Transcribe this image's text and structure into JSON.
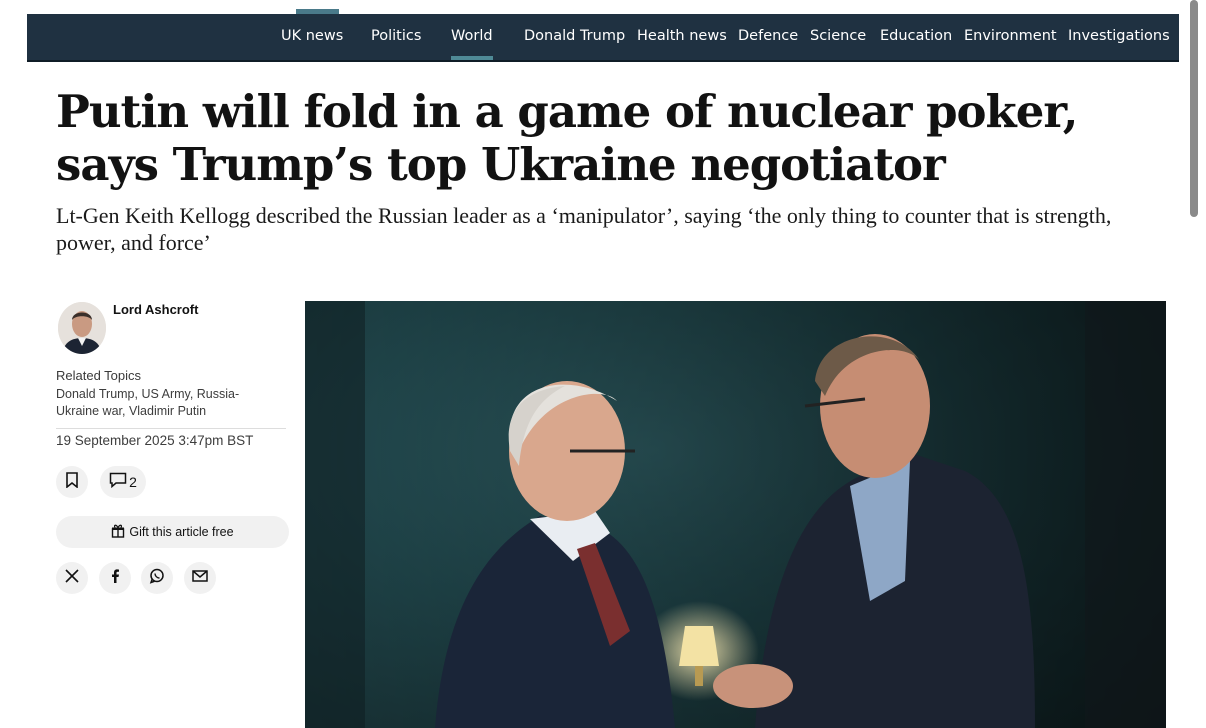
{
  "nav": {
    "items": [
      {
        "label": "UK news",
        "active": false
      },
      {
        "label": "Politics",
        "active": false
      },
      {
        "label": "World",
        "active": true
      },
      {
        "label": "Donald Trump",
        "active": false
      },
      {
        "label": "Health news",
        "active": false
      },
      {
        "label": "Defence",
        "active": false
      },
      {
        "label": "Science",
        "active": false
      },
      {
        "label": "Education",
        "active": false
      },
      {
        "label": "Environment",
        "active": false
      },
      {
        "label": "Investigations",
        "active": false
      }
    ]
  },
  "article": {
    "headline": "Putin will fold in a game of nuclear poker, says Trump’s top Ukraine negotiator",
    "standfirst": "Lt-Gen Keith Kellogg described the Russian leader as a ‘manipulator’, saying ‘the only thing to counter that is strength, power, and force’",
    "author": "Lord Ashcroft",
    "related_label": "Related Topics",
    "related_topics": "Donald Trump, US Army, Russia-Ukraine war, Vladimir Putin",
    "timestamp": "19 September 2025 3:47pm BST",
    "comment_count": "2",
    "gift_label": "Gift this article free"
  },
  "icons": {
    "bookmark": "bookmark-icon",
    "comments": "comment-icon",
    "gift": "gift-icon",
    "share": [
      "x-icon",
      "facebook-icon",
      "whatsapp-icon",
      "email-icon"
    ]
  },
  "colors": {
    "nav_bg": "#1f3141",
    "nav_active": "#4f8a96",
    "headline": "#121212",
    "pill_bg": "#f1f1f1"
  }
}
